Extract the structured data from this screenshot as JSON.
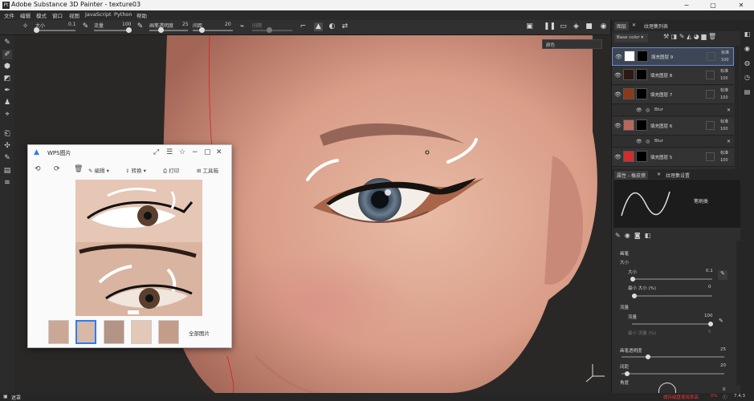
{
  "window": {
    "logo": "Pt",
    "title": "Adobe Substance 3D Painter - texture03",
    "min": "−",
    "max": "▢",
    "close": "✕"
  },
  "menu": [
    "文件",
    "编辑",
    "模式",
    "窗口",
    "视图",
    "JavaScript",
    "Python",
    "帮助"
  ],
  "toolbar": {
    "size_label": "大小",
    "size_value": "0.1",
    "flow_label": "流量",
    "flow_value": "100",
    "stroke_opacity_label": "画笔透明度",
    "stroke_opacity_value": "25",
    "spacing_label": "间距",
    "spacing_value": "20",
    "disabled_label": "间隔"
  },
  "viewport": {
    "channel_selector": "颜色"
  },
  "layers_panel": {
    "tab_layers": "图层",
    "tab_texset": "纹理集列表",
    "channel": "Base color",
    "layers": [
      {
        "name": "填充图层 9",
        "mode": "标准",
        "opacity": "100",
        "color": "#ffffff",
        "selected": true
      },
      {
        "name": "填充图层 8",
        "mode": "标准",
        "opacity": "100",
        "color": "#2a1a14",
        "selected": false
      },
      {
        "name": "填充图层 7",
        "mode": "标准",
        "opacity": "100",
        "color": "#8a3a18",
        "selected": false
      },
      {
        "name": "填充图层 6",
        "mode": "标准",
        "opacity": "100",
        "color": "#b8685a",
        "selected": false
      },
      {
        "name": "填充图层 5",
        "mode": "标准",
        "opacity": "100",
        "color": "#d22c2c",
        "selected": false
      }
    ],
    "blur_label": "Blur"
  },
  "properties": {
    "tab_properties": "属性 - 橡皮擦",
    "tab_texset_settings": "纹理集设置",
    "brush_name": "笔刷类",
    "section_brush": "画笔",
    "size_label": "大小",
    "size_sub": "大小",
    "size_value": "0.1",
    "min_size_label": "最小 大小 (%)",
    "min_size_value": "0",
    "section_flow": "流量",
    "flow_sub": "流量",
    "flow_value": "100",
    "min_flow_label": "最小 流量 (%)",
    "min_flow_value": "0",
    "stroke_opacity_label": "画笔透明度",
    "stroke_opacity_value": "25",
    "spacing_label": "间距",
    "spacing_value": "20",
    "angle_label": "角度",
    "angle_value": "0"
  },
  "wps": {
    "title": "WPS图片",
    "edit": "编辑",
    "convert": "转换",
    "print": "打印",
    "toolbox": "工具箱",
    "all_images": "全部图片"
  },
  "statusbar": {
    "left_label": "遮罩",
    "warning": "缓存磁盘使用率高",
    "percent": "0%",
    "version": "7.4.3"
  }
}
